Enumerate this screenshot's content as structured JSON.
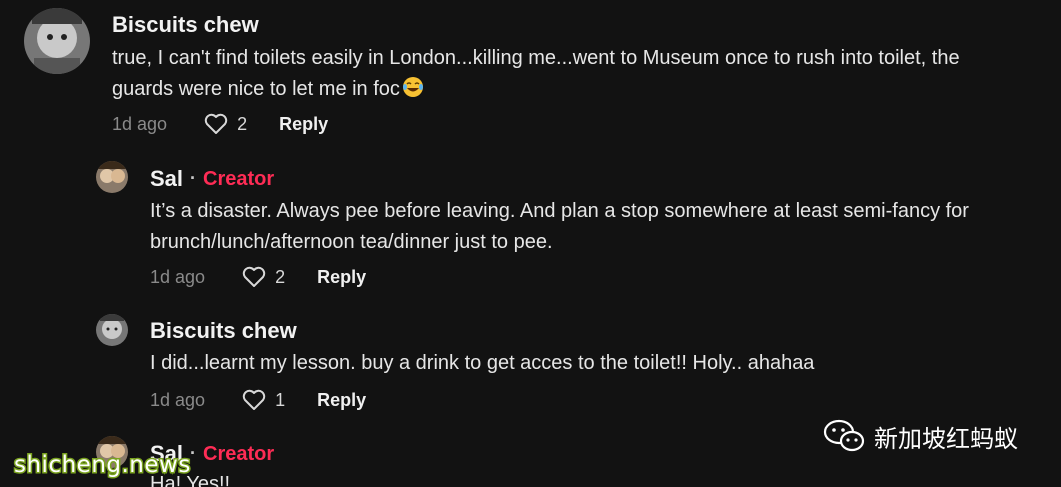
{
  "comments": [
    {
      "username": "Biscuits chew",
      "lines": [
        "true, I can't find toilets easily in London...killing me...went to Museum once to rush into toilet, the",
        "guards were nice to let me in foc"
      ],
      "emoji": "face-with-tears-of-joy",
      "time": "1d ago",
      "likes": "2",
      "reply_label": "Reply"
    },
    {
      "username": "Sal",
      "separator": "·",
      "badge": "Creator",
      "lines": [
        "It’s a disaster. Always pee before leaving. And plan a stop somewhere at least semi-fancy for",
        "brunch/lunch/afternoon tea/dinner just to pee."
      ],
      "time": "1d ago",
      "likes": "2",
      "reply_label": "Reply"
    },
    {
      "username": "Biscuits chew",
      "lines": [
        "I did...learnt my lesson. buy a drink to get acces to the toilet!! Holy.. ahahaa"
      ],
      "time": "1d ago",
      "likes": "1",
      "reply_label": "Reply"
    },
    {
      "username": "Sal",
      "separator": "·",
      "badge": "Creator",
      "lines": [
        "Ha! Yes!!"
      ]
    }
  ],
  "watermarks": {
    "wechat_account": "新加坡红蚂蚁",
    "site": "shicheng.news"
  },
  "colors": {
    "background": "#121212",
    "creator_badge": "#fe2c55",
    "muted_text": "#8a8a8a"
  },
  "icons": [
    "heart-icon",
    "face-with-tears-of-joy-icon",
    "wechat-icon",
    "avatar"
  ]
}
